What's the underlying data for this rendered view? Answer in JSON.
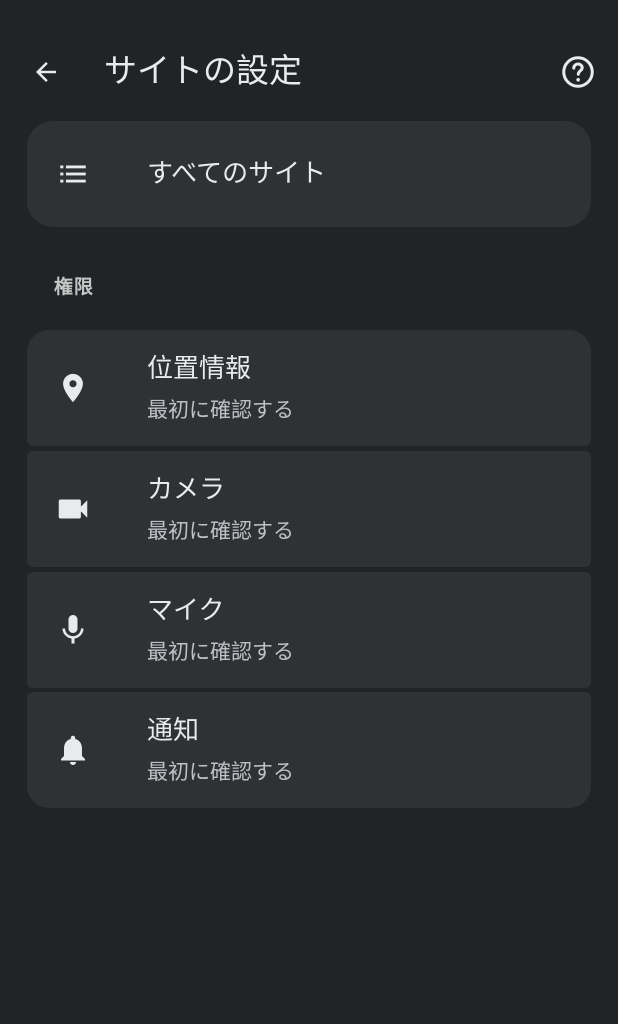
{
  "header": {
    "title": "サイトの設定",
    "back_icon": "arrow-back-icon",
    "help_icon": "help-circle-icon"
  },
  "all_sites": {
    "label": "すべてのサイト",
    "icon": "list-icon"
  },
  "permissions": {
    "section_title": "権限",
    "items": [
      {
        "label": "位置情報",
        "status": "最初に確認する",
        "icon": "location-pin-icon"
      },
      {
        "label": "カメラ",
        "status": "最初に確認する",
        "icon": "video-camera-icon"
      },
      {
        "label": "マイク",
        "status": "最初に確認する",
        "icon": "microphone-icon"
      },
      {
        "label": "通知",
        "status": "最初に確認する",
        "icon": "bell-icon"
      }
    ]
  },
  "colors": {
    "background": "#222327",
    "card": "#303134",
    "text_primary": "#e8eaed",
    "text_secondary": "#bdc1c6"
  }
}
